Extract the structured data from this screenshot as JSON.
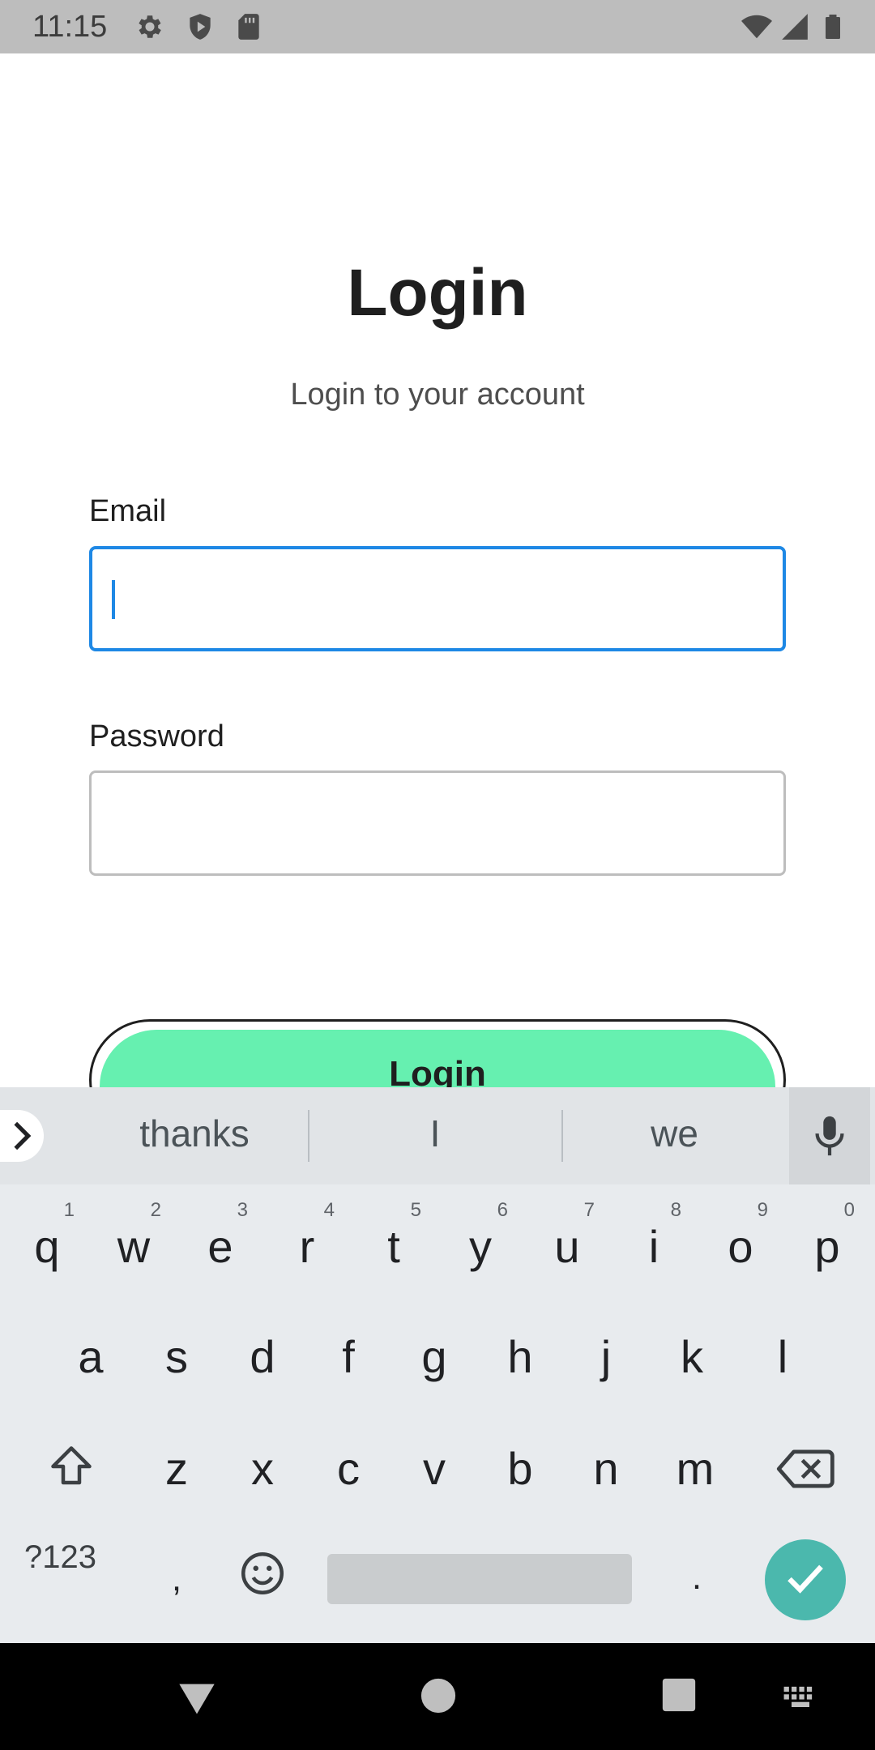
{
  "status_bar": {
    "time": "11:15",
    "left_icons": [
      "gear-icon",
      "shield-play-icon",
      "sd-card-icon"
    ],
    "right_icons": [
      "wifi-icon",
      "signal-icon",
      "battery-icon"
    ]
  },
  "page": {
    "title": "Login",
    "subtitle": "Login to your account",
    "email_label": "Email",
    "email_value": "",
    "password_label": "Password",
    "password_value": "",
    "login_button_label": "Login"
  },
  "keyboard": {
    "suggestions": [
      "thanks",
      "I",
      "we"
    ],
    "row1": [
      {
        "key": "q",
        "hint": "1"
      },
      {
        "key": "w",
        "hint": "2"
      },
      {
        "key": "e",
        "hint": "3"
      },
      {
        "key": "r",
        "hint": "4"
      },
      {
        "key": "t",
        "hint": "5"
      },
      {
        "key": "y",
        "hint": "6"
      },
      {
        "key": "u",
        "hint": "7"
      },
      {
        "key": "i",
        "hint": "8"
      },
      {
        "key": "o",
        "hint": "9"
      },
      {
        "key": "p",
        "hint": "0"
      }
    ],
    "row2": [
      "a",
      "s",
      "d",
      "f",
      "g",
      "h",
      "j",
      "k",
      "l"
    ],
    "row3": [
      "z",
      "x",
      "c",
      "v",
      "b",
      "n",
      "m"
    ],
    "symbols_label": "?123",
    "comma": ",",
    "period": ".",
    "accent_color": "#4bb8ad"
  },
  "colors": {
    "focus_blue": "#1e88e5",
    "button_green": "#66f0b0"
  }
}
